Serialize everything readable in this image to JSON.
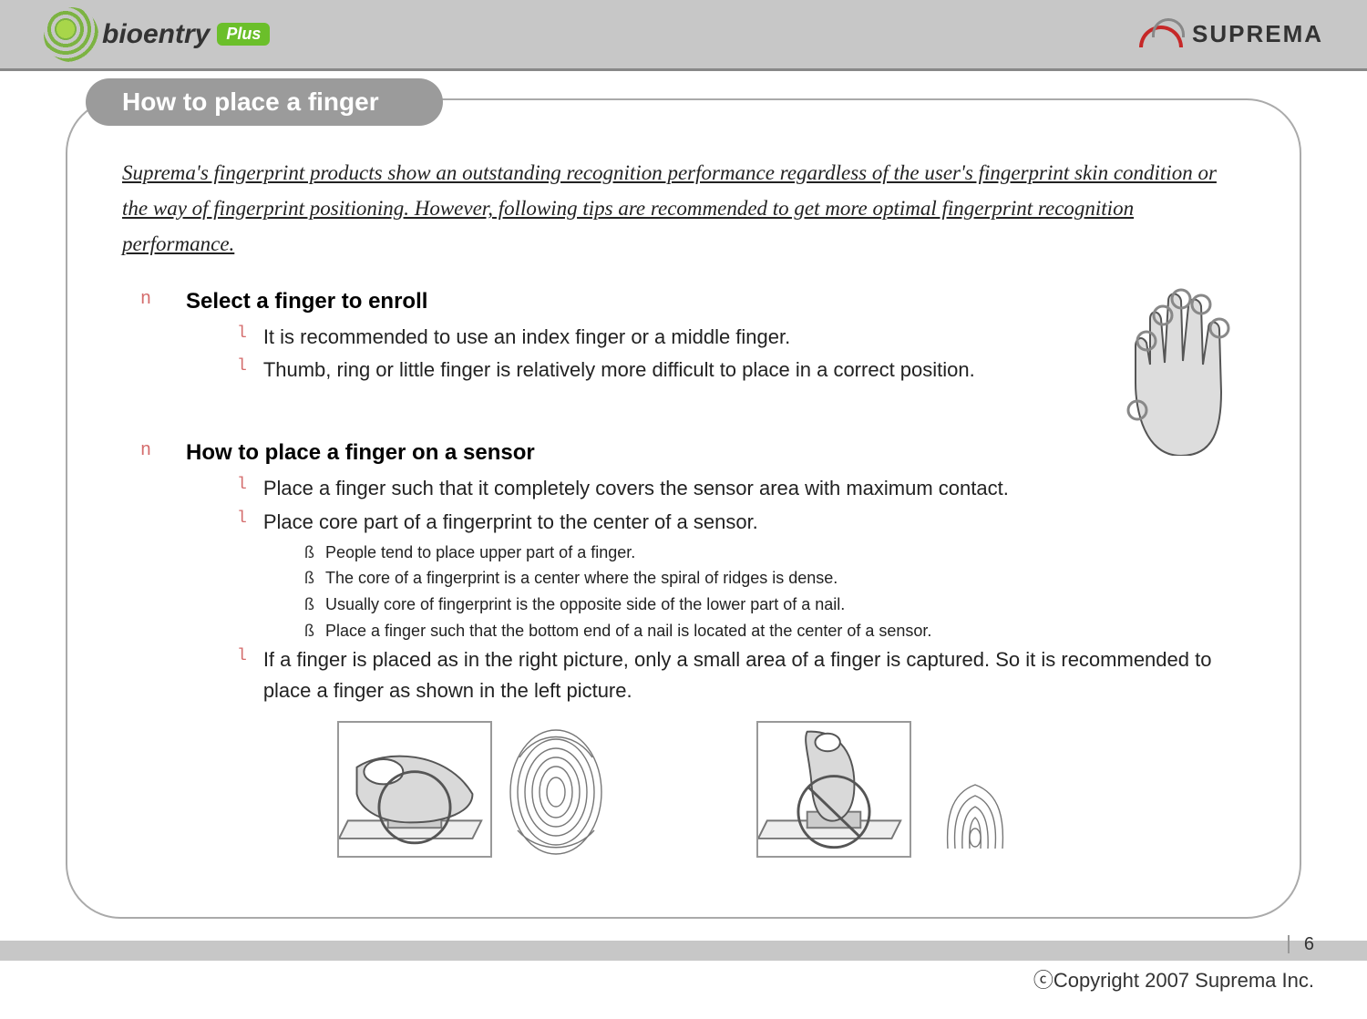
{
  "header": {
    "brand_left_main": "bioentry",
    "brand_left_badge": "Plus",
    "brand_right": "SUPREMA"
  },
  "title": "How to place a finger",
  "intro": "Suprema's fingerprint products show an outstanding recognition performance regardless of the user's fingerprint skin condition or the way of fingerprint positioning. However, following tips are recommended to get more optimal fingerprint recognition performance.",
  "bullets": {
    "level1": "n",
    "level2": "l",
    "level3": "ß"
  },
  "sections": [
    {
      "heading": "Select a finger to enroll",
      "items": [
        {
          "text": "It is recommended to use an index finger or a middle finger."
        },
        {
          "text": "Thumb, ring or little finger is relatively more difficult to place in a correct position."
        }
      ]
    },
    {
      "heading": "How to place a finger on a sensor",
      "items": [
        {
          "text": "Place a finger such that it completely covers the sensor area with maximum contact."
        },
        {
          "text": "Place core part of a fingerprint to the center of a sensor.",
          "sub": [
            "People tend to place upper part of a finger.",
            "The core of a fingerprint is a center where the spiral of ridges is dense.",
            "Usually core of fingerprint is the opposite side of the lower part of a nail.",
            "Place a finger such that the bottom end of a nail is located at the center of a sensor."
          ]
        },
        {
          "text": "If a finger is placed as in the right picture, only a small area of a finger is captured. So it is recommended to place a finger as shown in the left picture."
        }
      ]
    }
  ],
  "footer": {
    "page": "6",
    "copyright": "ⓒCopyright 2007 Suprema Inc."
  }
}
